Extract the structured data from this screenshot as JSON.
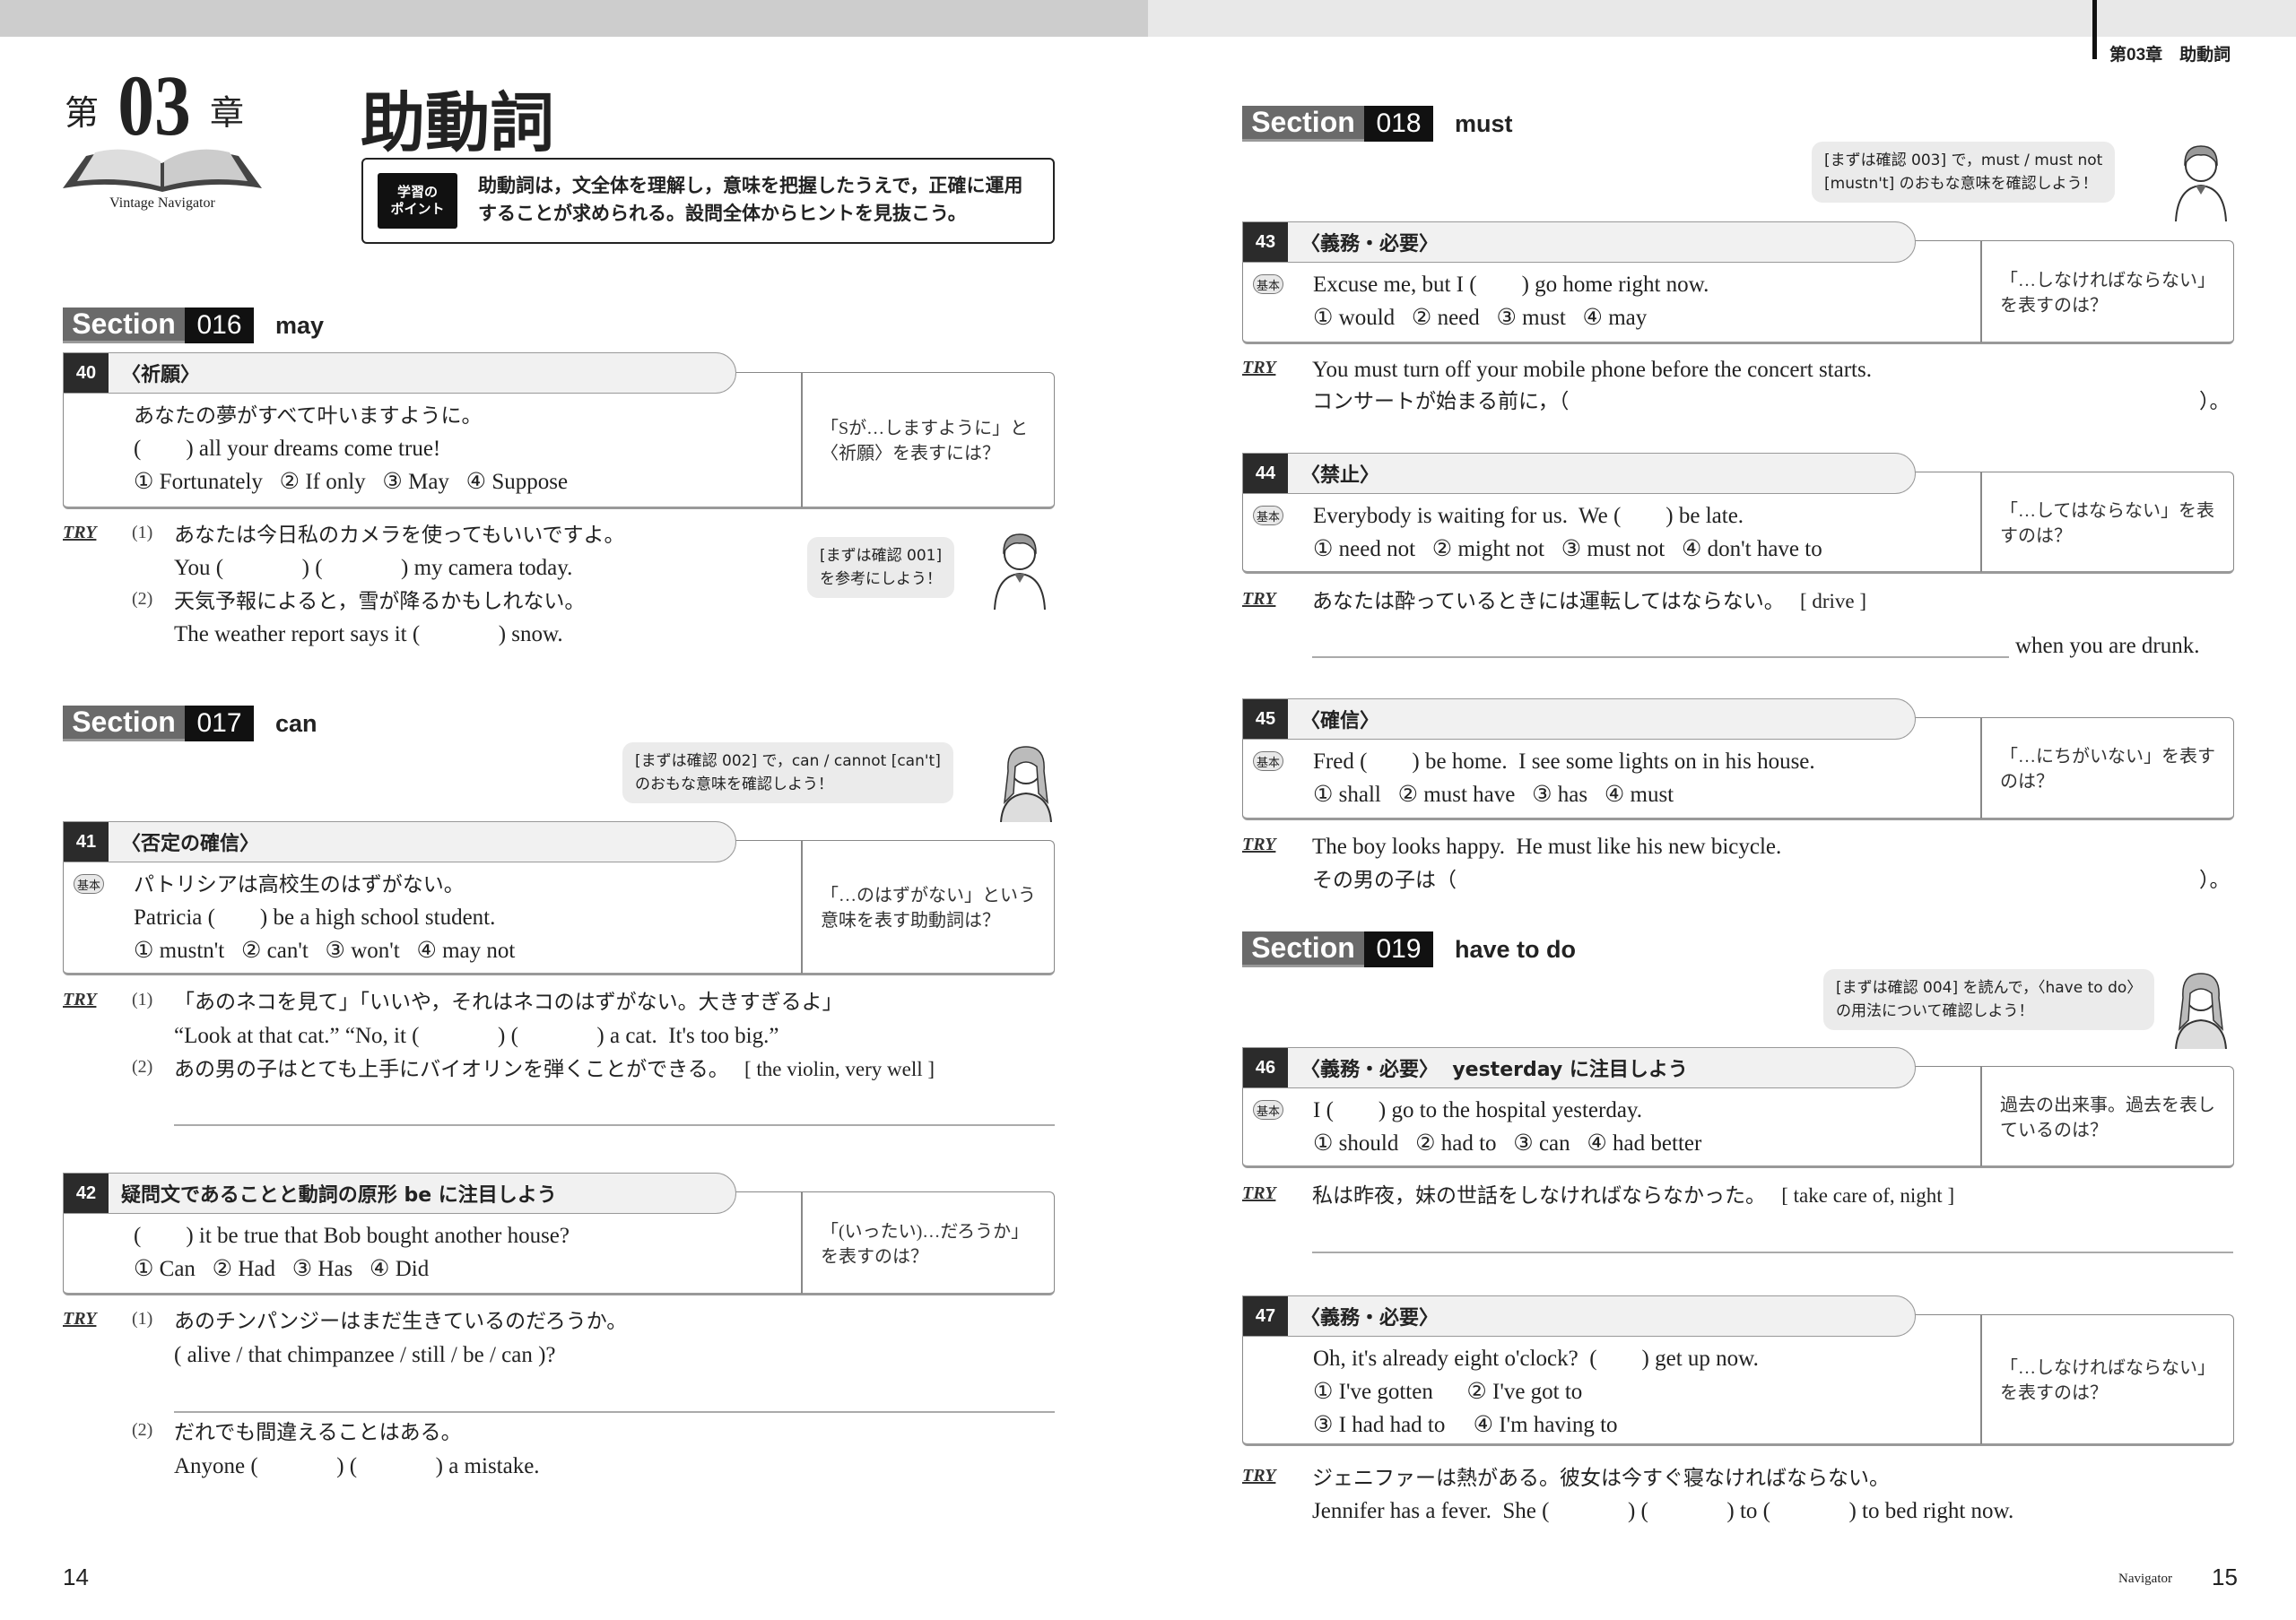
{
  "left_page": {
    "chapter": {
      "prefix": "第",
      "number": "03",
      "suffix": "章"
    },
    "logo_text": "Vintage Navigator",
    "title": "助動詞",
    "point": {
      "badge": [
        "学習の",
        "ポイント"
      ],
      "lines": [
        "助動詞は，文全体を理解し，意味を把握したうえで，正確に運用",
        "することが求められる。設問全体からヒントを見抜こう。"
      ]
    },
    "page_number": "14"
  },
  "right_page": {
    "running_head": "第03章　助動詞",
    "footer_label": "Navigator",
    "page_number": "15"
  },
  "sections": [
    {
      "label": "Section",
      "number": "016",
      "topic": "may"
    },
    {
      "label": "Section",
      "number": "017",
      "topic": "can"
    },
    {
      "label": "Section",
      "number": "018",
      "topic": "must"
    },
    {
      "label": "Section",
      "number": "019",
      "topic": "have to do"
    }
  ],
  "bubbles": [
    {
      "lines": [
        "[まずは確認 001]",
        "を参考にしよう！"
      ],
      "character": "boy-ok-sign"
    },
    {
      "lines": [
        "[まずは確認 002] で，can / cannot [can't]",
        "のおもな意味を確認しよう！"
      ],
      "character": "girl-ok-sign"
    },
    {
      "lines": [
        "[まずは確認 003] で，must / must not",
        "[mustn't] のおもな意味を確認しよう！"
      ],
      "character": "boy-thumbs-up"
    },
    {
      "lines": [
        "[まずは確認 004] を読んで，〈have to do〉",
        "の用法について確認しよう！"
      ],
      "character": "girl"
    }
  ],
  "questions": [
    {
      "number": "40",
      "category": "〈祈願〉",
      "badge": "",
      "lines": [
        "あなたの夢がすべて叶いますように。",
        "(        ) all your dreams come true!",
        "① Fortunately   ② If only   ③ May   ④ Suppose"
      ],
      "hint": [
        "「Sが…しますように」と",
        "〈祈願〉を表すには？"
      ]
    },
    {
      "number": "41",
      "category": "〈否定の確信〉",
      "badge": "基本",
      "lines": [
        "パトリシアは高校生のはずがない。",
        "Patricia (        ) be a high school student.",
        "① mustn't   ② can't   ③ won't   ④ may not"
      ],
      "hint": [
        "「…のはずがない」という",
        "意味を表す助動詞は？"
      ]
    },
    {
      "number": "42",
      "category": "疑問文であることと動詞の原形 be に注目しよう",
      "badge": "",
      "lines": [
        "(        ) it be true that Bob bought another house?",
        "① Can   ② Had   ③ Has   ④ Did"
      ],
      "hint": [
        "「(いったい)…だろうか」",
        "を表すのは？"
      ]
    },
    {
      "number": "43",
      "category": "〈義務・必要〉",
      "badge": "基本",
      "lines": [
        "Excuse me, but I (        ) go home right now.",
        "① would   ② need   ③ must   ④ may"
      ],
      "hint": [
        "「…しなければならない」",
        "を表すのは？"
      ]
    },
    {
      "number": "44",
      "category": "〈禁止〉",
      "badge": "基本",
      "lines": [
        "Everybody is waiting for us.  We (        ) be late.",
        "① need not   ② might not   ③ must not   ④ don't have to"
      ],
      "hint": [
        "「…してはならない」を表",
        "すのは？"
      ]
    },
    {
      "number": "45",
      "category": "〈確信〉",
      "badge": "基本",
      "lines": [
        "Fred (        ) be home.  I see some lights on in his house.",
        "① shall   ② must have   ③ has   ④ must"
      ],
      "hint": [
        "「…にちがいない」を表す",
        "のは？"
      ]
    },
    {
      "number": "46",
      "category": "〈義務・必要〉  yesterday に注目しよう",
      "badge": "基本",
      "lines": [
        "I (        ) go to the hospital yesterday.",
        "① should   ② had to   ③ can   ④ had better"
      ],
      "hint": [
        "過去の出来事。過去を表し",
        "ているのは？"
      ]
    },
    {
      "number": "47",
      "category": "〈義務・必要〉",
      "badge": "",
      "lines": [
        "Oh, it's already eight o'clock?  (        ) get up now.",
        "① I've gotten      ② I've got to",
        "③ I had had to     ④ I'm having to"
      ],
      "hint": [
        "「…しなければならない」",
        "を表すのは？"
      ]
    }
  ],
  "try_blocks": [
    {
      "label": "TRY",
      "items": [
        {
          "marker": "(1)",
          "lines": [
            "あなたは今日私のカメラを使ってもいいですよ。",
            "You (              ) (              ) my camera today."
          ]
        },
        {
          "marker": "(2)",
          "lines": [
            "天気予報によると，雪が降るかもしれない。",
            "The weather report says it (              ) snow."
          ]
        }
      ]
    },
    {
      "label": "TRY",
      "items": [
        {
          "marker": "(1)",
          "lines": [
            "「あのネコを見て」「いいや，それはネコのはずがない。大きすぎるよ」",
            "“Look at that cat.” “No, it (              ) (              ) a cat.  It's too big.”"
          ]
        },
        {
          "marker": "(2)",
          "lines": [
            "あの男の子はとても上手にバイオリンを弾くことができる。   [ the violin, very well ]"
          ]
        }
      ]
    },
    {
      "label": "TRY",
      "items": [
        {
          "marker": "(1)",
          "lines": [
            "あのチンパンジーはまだ生きているのだろうか。",
            "( alive / that chimpanzee / still / be / can )?"
          ]
        },
        {
          "marker": "(2)",
          "lines": [
            "だれでも間違えることはある。",
            "Anyone (              ) (              ) a mistake."
          ]
        }
      ]
    },
    {
      "label": "TRY",
      "items": [
        {
          "marker": "",
          "lines": [
            "You must turn off your mobile phone before the concert starts.",
            "コンサートが始まる前に，（"
          ],
          "line_end": "）。"
        }
      ]
    },
    {
      "label": "TRY",
      "items": [
        {
          "marker": "",
          "lines": [
            "あなたは酔っているときには運転してはならない。   [ drive ]"
          ],
          "answer_suffix": "when you are drunk."
        }
      ]
    },
    {
      "label": "TRY",
      "items": [
        {
          "marker": "",
          "lines": [
            "The boy looks happy.  He must like his new bicycle.",
            "その男の子は（"
          ],
          "line_end": "）。"
        }
      ]
    },
    {
      "label": "TRY",
      "items": [
        {
          "marker": "",
          "lines": [
            "私は昨夜，妹の世話をしなければならなかった。   [ take care of, night ]"
          ]
        }
      ]
    },
    {
      "label": "TRY",
      "items": [
        {
          "marker": "",
          "lines": [
            "ジェニファーは熱がある。彼女は今すぐ寝なければならない。",
            "Jennifer has a fever.  She (              ) (              ) to (              ) to bed right now."
          ]
        }
      ]
    }
  ]
}
